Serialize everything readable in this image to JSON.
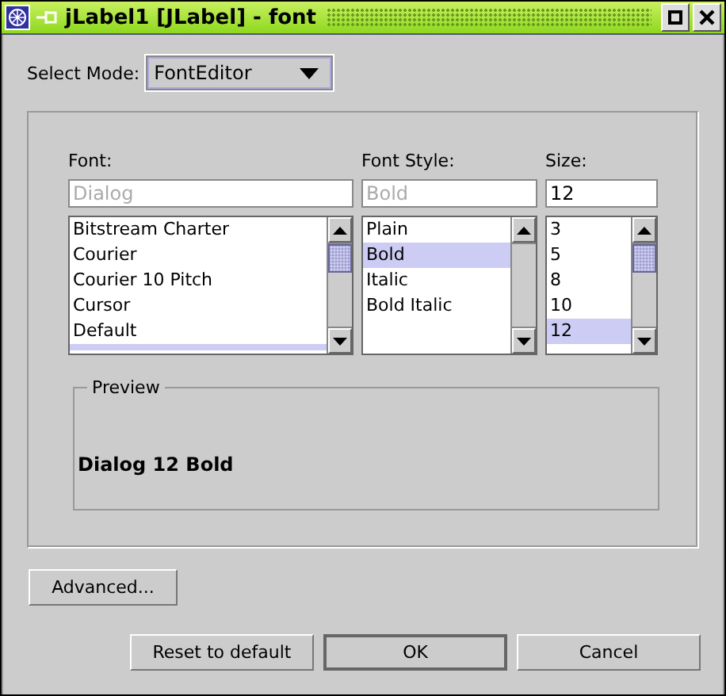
{
  "window": {
    "title": "jLabel1 [JLabel] - font"
  },
  "mode": {
    "label": "Select Mode:",
    "value": "FontEditor"
  },
  "font": {
    "label": "Font:",
    "placeholder": "Dialog",
    "items": [
      {
        "label": "Bitstream Charter",
        "selected": false
      },
      {
        "label": "Courier",
        "selected": false
      },
      {
        "label": "Courier 10 Pitch",
        "selected": false
      },
      {
        "label": "Cursor",
        "selected": false
      },
      {
        "label": "Default",
        "selected": false
      }
    ]
  },
  "style": {
    "label": "Font Style:",
    "placeholder": "Bold",
    "items": [
      {
        "label": "Plain",
        "selected": false
      },
      {
        "label": "Bold",
        "selected": true
      },
      {
        "label": "Italic",
        "selected": false
      },
      {
        "label": "Bold Italic",
        "selected": false
      }
    ]
  },
  "size": {
    "label": "Size:",
    "value": "12",
    "items": [
      {
        "label": "3",
        "selected": false
      },
      {
        "label": "5",
        "selected": false
      },
      {
        "label": "8",
        "selected": false
      },
      {
        "label": "10",
        "selected": false
      },
      {
        "label": "12",
        "selected": true
      }
    ]
  },
  "preview": {
    "title": "Preview",
    "text": "Dialog 12 Bold"
  },
  "buttons": {
    "advanced": "Advanced...",
    "reset": "Reset to default",
    "ok": "OK",
    "cancel": "Cancel"
  }
}
